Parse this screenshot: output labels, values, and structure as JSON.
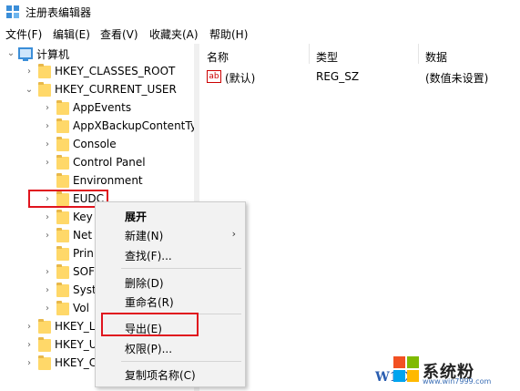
{
  "window": {
    "title": "注册表编辑器"
  },
  "menubar": {
    "items": [
      {
        "label": "文件(F)"
      },
      {
        "label": "编辑(E)"
      },
      {
        "label": "查看(V)"
      },
      {
        "label": "收藏夹(A)"
      },
      {
        "label": "帮助(H)"
      }
    ]
  },
  "tree": {
    "root": "计算机",
    "hkcr": "HKEY_CLASSES_ROOT",
    "hkcu": "HKEY_CURRENT_USER",
    "children": [
      {
        "label": "AppEvents"
      },
      {
        "label": "AppXBackupContentTy"
      },
      {
        "label": "Console"
      },
      {
        "label": "Control Panel"
      },
      {
        "label": "Environment"
      },
      {
        "label": "EUDC"
      },
      {
        "label": "Key"
      },
      {
        "label": "Net"
      },
      {
        "label": "Prin"
      },
      {
        "label": "SOF"
      },
      {
        "label": "Syst"
      },
      {
        "label": "Vol"
      }
    ],
    "tail": [
      {
        "label": "HKEY_L"
      },
      {
        "label": "HKEY_U"
      },
      {
        "label": "HKEY_C"
      }
    ]
  },
  "list": {
    "columns": {
      "name": "名称",
      "type": "类型",
      "data": "数据"
    },
    "rows": [
      {
        "icon": "ab",
        "name": "(默认)",
        "type": "REG_SZ",
        "data": "(数值未设置)"
      }
    ]
  },
  "context_menu": {
    "expand": "展开",
    "new": "新建(N)",
    "find": "查找(F)...",
    "delete": "删除(D)",
    "rename": "重命名(R)",
    "export": "导出(E)",
    "permissions": "权限(P)...",
    "copy_key_name": "复制项名称(C)",
    "submenu_arrow": "›"
  },
  "watermark": {
    "brand": "系统粉",
    "url": "www.win7999.com",
    "w10": "W1C"
  },
  "colors": {
    "highlight": "#e0141e",
    "folder": "#ffd869"
  }
}
